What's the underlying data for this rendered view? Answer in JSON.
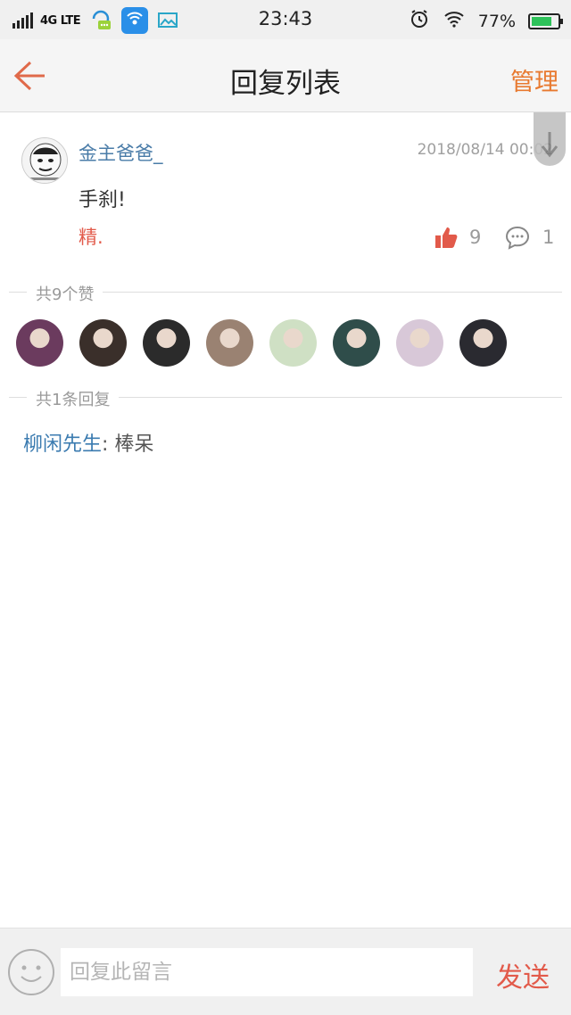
{
  "status_bar": {
    "network": "4G LTE",
    "time": "23:43",
    "battery": "77%",
    "battery_level": 0.77,
    "icons": [
      "signal-icon",
      "qq-icon",
      "wifi-hotspot-icon",
      "gallery-icon",
      "alarm-icon",
      "wifi-icon",
      "battery-icon"
    ]
  },
  "header": {
    "back_icon": "back-arrow-icon",
    "title": "回复列表",
    "manage_label": "管理"
  },
  "post": {
    "username": "金主爸爸_",
    "timestamp": "2018/08/14 00:02",
    "text": "手刹!",
    "tag": "精.",
    "like_count": "9",
    "comment_count": "1"
  },
  "likes_section": {
    "label": "共9个赞",
    "avatar_colors": [
      "#6b3b5e",
      "#3a2f2a",
      "#2b2b2b",
      "#9a8272",
      "#cfe0c4",
      "#2f4d4a",
      "#d8c8d8",
      "#2a2a30"
    ]
  },
  "replies_section": {
    "label": "共1条回复",
    "items": [
      {
        "author": "柳闲先生",
        "separator": ": ",
        "text": "棒呆"
      }
    ]
  },
  "composer": {
    "placeholder": "回复此留言",
    "send_label": "发送"
  },
  "colors": {
    "accent_orange": "#e8792f",
    "accent_red": "#e25a4a",
    "link_blue": "#4a7ca8"
  }
}
